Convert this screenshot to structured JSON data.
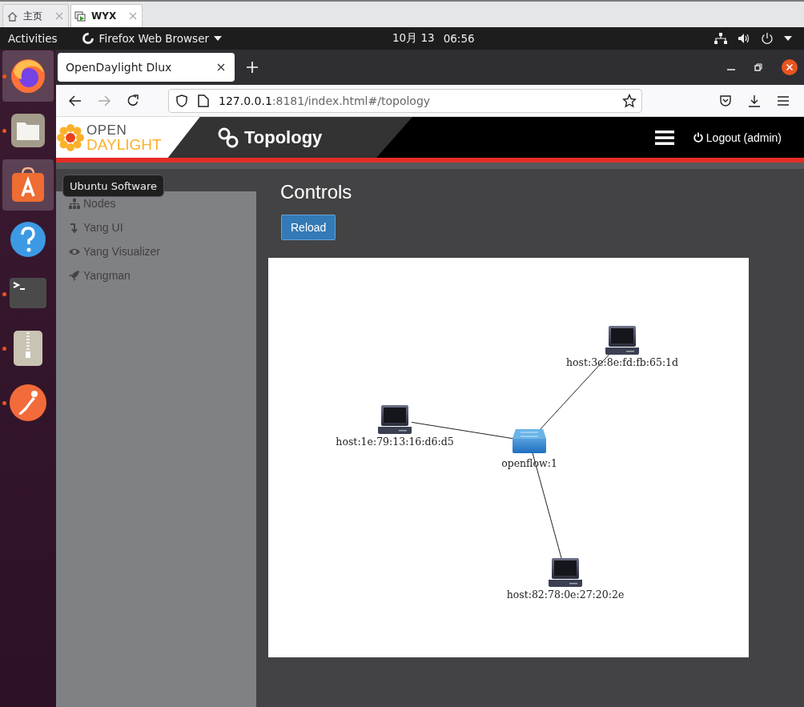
{
  "vm_tabs": [
    {
      "label": "主页",
      "kind": "home",
      "selected": false
    },
    {
      "label": "WYX",
      "kind": "vm",
      "selected": true
    }
  ],
  "top_bar": {
    "activities": "Activities",
    "app_menu": "Firefox Web Browser",
    "date": "10月 13",
    "time": "06:56"
  },
  "dock": {
    "items": [
      {
        "kind": "firefox",
        "highlighted": true,
        "running": true
      },
      {
        "kind": "files",
        "highlighted": false,
        "running": true
      },
      {
        "kind": "software",
        "highlighted": true,
        "running": false
      },
      {
        "kind": "help",
        "highlighted": false,
        "running": false
      },
      {
        "kind": "terminal",
        "highlighted": false,
        "running": true
      },
      {
        "kind": "archive",
        "highlighted": false,
        "running": true
      },
      {
        "kind": "postman",
        "highlighted": false,
        "running": true
      }
    ],
    "tooltip": "Ubuntu Software"
  },
  "browser": {
    "tabs": [
      {
        "title": "OpenDaylight Dlux",
        "selected": true
      }
    ],
    "url_host": "127.0.0.1",
    "url_rest": ":8181/index.html#/topology"
  },
  "app": {
    "logo_top": "OPEN",
    "logo_bottom": "DAYLIGHT",
    "title": "Topology",
    "logout": "Logout (admin)",
    "sidebar": [
      {
        "label": "Nodes",
        "kind": "nodes"
      },
      {
        "label": "Yang UI",
        "kind": "yangui"
      },
      {
        "label": "Yang Visualizer",
        "kind": "visualizer"
      },
      {
        "label": "Yangman",
        "kind": "yangman"
      }
    ],
    "heading": "Controls",
    "reload": "Reload",
    "topology": {
      "nodes": [
        {
          "label": "host:3e:8e:fd:fb:65:1d",
          "kind": "host",
          "linked": true
        },
        {
          "label": "host:1e:79:13:16:d6:d5",
          "kind": "host",
          "linked": true
        },
        {
          "label": "openflow:1",
          "kind": "switch"
        },
        {
          "label": "host:82:78:0e:27:20:2e",
          "kind": "host",
          "linked": true
        }
      ]
    }
  }
}
